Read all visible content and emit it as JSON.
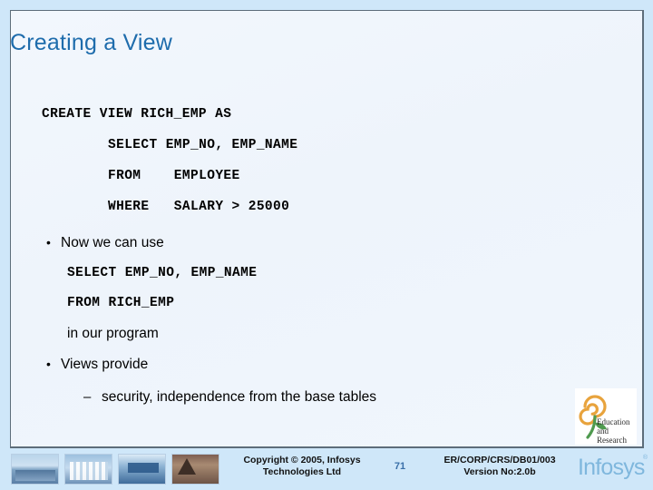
{
  "slide": {
    "title": "Creating a View",
    "accent_color": "#1e6cac",
    "background_color": "#f0f5fc",
    "border_color": "#cfe7f9"
  },
  "code_block": {
    "lines": [
      "CREATE VIEW RICH_EMP AS",
      "SELECT EMP_NO, EMP_NAME",
      "FROM    EMPLOYEE",
      "WHERE   SALARY > 25000"
    ]
  },
  "bullets": [
    {
      "marker": "•",
      "text": "Now we can use",
      "code_lines": [
        "SELECT EMP_NO, EMP_NAME",
        "FROM RICH_EMP"
      ],
      "trailing_text": "in our program"
    },
    {
      "marker": "•",
      "text": "Views provide",
      "sub": {
        "marker": "–",
        "text": "security, independence from the base tables"
      }
    }
  ],
  "er_logo": {
    "line1": "Education",
    "line2": "and",
    "line3": "Research",
    "flower_color": "#e8a33d",
    "stem_color": "#4f9a4f"
  },
  "footer": {
    "copyright": "Copyright © 2005, Infosys Technologies Ltd",
    "page_number": "71",
    "doc_id": "ER/CORP/CRS/DB01/003",
    "version": "Version No:2.0b",
    "brand": "Infosys",
    "brand_registered": "®",
    "brand_color": "#7fb7dd"
  }
}
